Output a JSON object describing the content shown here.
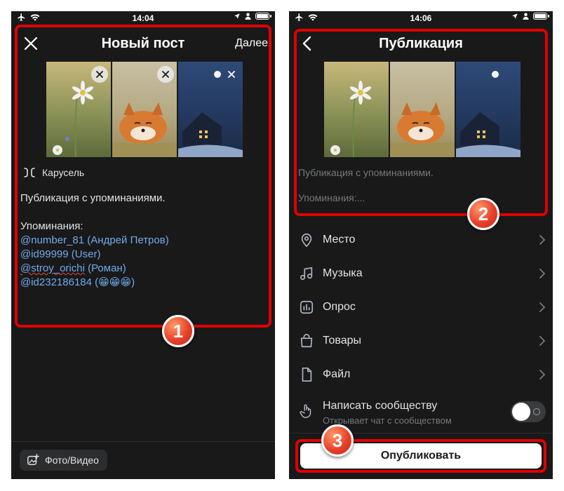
{
  "colors": {
    "background": "#19191a",
    "accent_link": "#71aaeb",
    "highlight": "#e00000",
    "badge": "#e8402a"
  },
  "left": {
    "status": {
      "time": "14:04"
    },
    "header": {
      "title": "Новый пост",
      "next_label": "Далее",
      "close_icon": "close-icon"
    },
    "carousel_label": "Карусель",
    "post": {
      "text": "Публикация с упоминаниями.",
      "mentions_heading": "Упоминания:",
      "mentions": [
        {
          "handle": "@number_81",
          "name": "(Андрей Петров)"
        },
        {
          "handle": "@id99999",
          "name": "(User)"
        },
        {
          "handle": "@stroy_orichi",
          "name": "(Роман)"
        },
        {
          "handle": "@id232186184",
          "name": "(😁😁😁)"
        }
      ]
    },
    "photo_video_label": "Фото/Видео",
    "badge": "1"
  },
  "right": {
    "status": {
      "time": "14:06"
    },
    "header": {
      "title": "Публикация",
      "back_icon": "back-icon"
    },
    "text_preview": "Публикация с упоминаниями.",
    "mentions_preview": "Упоминания:...",
    "menu": [
      {
        "icon": "place-icon",
        "label": "Место"
      },
      {
        "icon": "music-icon",
        "label": "Музыка"
      },
      {
        "icon": "poll-icon",
        "label": "Опрос"
      },
      {
        "icon": "goods-icon",
        "label": "Товары"
      },
      {
        "icon": "file-icon",
        "label": "Файл"
      }
    ],
    "message": {
      "label": "Написать сообществу",
      "sub": "Открывает чат с сообществом",
      "enabled": false
    },
    "publish_label": "Опубликовать",
    "badge_2": "2",
    "badge_3": "3"
  }
}
